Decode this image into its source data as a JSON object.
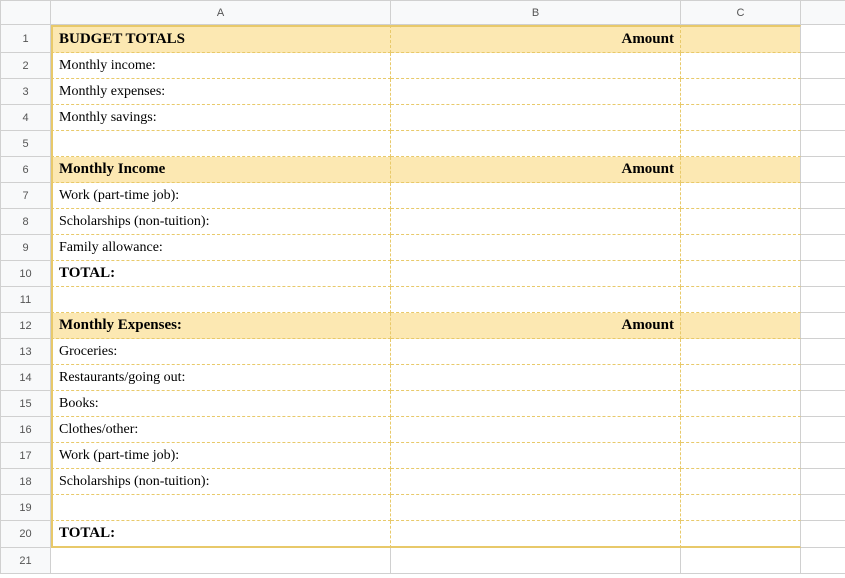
{
  "columns": [
    "A",
    "B",
    "C"
  ],
  "rows": [
    {
      "num": "1",
      "a": "BUDGET TOTALS",
      "b": "Amount",
      "c": "",
      "header": true,
      "bold": true
    },
    {
      "num": "2",
      "a": "Monthly income:",
      "b": "",
      "c": ""
    },
    {
      "num": "3",
      "a": "Monthly expenses:",
      "b": "",
      "c": ""
    },
    {
      "num": "4",
      "a": "Monthly savings:",
      "b": "",
      "c": ""
    },
    {
      "num": "5",
      "a": "",
      "b": "",
      "c": ""
    },
    {
      "num": "6",
      "a": "Monthly Income",
      "b": "Amount",
      "c": "",
      "header": true,
      "bold": true
    },
    {
      "num": "7",
      "a": "Work (part-time job):",
      "b": "",
      "c": ""
    },
    {
      "num": "8",
      "a": "Scholarships (non-tuition):",
      "b": "",
      "c": ""
    },
    {
      "num": "9",
      "a": "Family allowance:",
      "b": "",
      "c": ""
    },
    {
      "num": "10",
      "a": "TOTAL:",
      "b": "",
      "c": "",
      "bold": true
    },
    {
      "num": "11",
      "a": "",
      "b": "",
      "c": ""
    },
    {
      "num": "12",
      "a": "Monthly Expenses:",
      "b": "Amount",
      "c": "",
      "header": true,
      "bold": true
    },
    {
      "num": "13",
      "a": "Groceries:",
      "b": "",
      "c": ""
    },
    {
      "num": "14",
      "a": "Restaurants/going out:",
      "b": "",
      "c": ""
    },
    {
      "num": "15",
      "a": "Books:",
      "b": "",
      "c": ""
    },
    {
      "num": "16",
      "a": "Clothes/other:",
      "b": "",
      "c": ""
    },
    {
      "num": "17",
      "a": "Work (part-time job):",
      "b": "",
      "c": ""
    },
    {
      "num": "18",
      "a": "Scholarships (non-tuition):",
      "b": "",
      "c": ""
    },
    {
      "num": "19",
      "a": "",
      "b": "",
      "c": ""
    },
    {
      "num": "20",
      "a": "TOTAL:",
      "b": "",
      "c": "",
      "bold": true
    },
    {
      "num": "21",
      "a": "",
      "b": "",
      "c": "",
      "outside": true
    }
  ]
}
